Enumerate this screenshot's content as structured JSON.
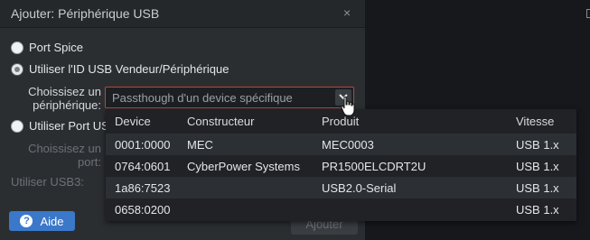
{
  "dialog": {
    "title": "Ajouter: Périphérique USB",
    "close": "×",
    "options": [
      {
        "label": "Port Spice",
        "checked": false
      },
      {
        "label": "Utiliser l'ID USB Vendeur/Périphérique",
        "checked": true
      },
      {
        "label": "Utiliser Port US",
        "checked": false
      }
    ],
    "choose_device_label_1": "Choissisez un",
    "choose_device_label_2": "périphérique:",
    "choose_port_label_1": "Choissisez un",
    "choose_port_label_2": "port:",
    "usb3_label": "Utiliser USB3:",
    "combo_value": "Passthough d'un device spécifique",
    "help_label": "Aide",
    "add_label": "Ajouter"
  },
  "dropdown": {
    "headers": [
      "Device",
      "Constructeur",
      "Produit",
      "Vitesse"
    ],
    "rows": [
      [
        "0001:0000",
        "MEC",
        "MEC0003",
        "USB 1.x"
      ],
      [
        "0764:0601",
        "CyberPower Systems",
        "PR1500ELCDRT2U",
        "USB 1.x"
      ],
      [
        "1a86:7523",
        "",
        "USB2.0-Serial",
        "USB 1.x"
      ],
      [
        "0658:0200",
        "",
        "",
        "USB 1.x"
      ]
    ]
  },
  "colors": {
    "accent": "#3b78c9",
    "combo_border": "#c0413d",
    "dialog_bg": "#2b2e31",
    "dropdown_bg": "#202225"
  }
}
